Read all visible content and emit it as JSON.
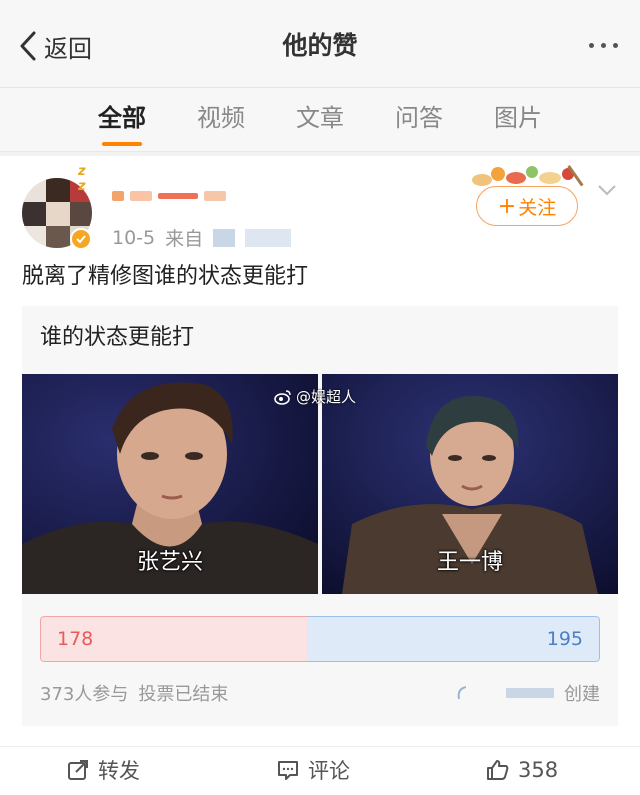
{
  "navbar": {
    "back_label": "返回",
    "title": "他的赞"
  },
  "tabs": [
    {
      "label": "全部",
      "active": true
    },
    {
      "label": "视频",
      "active": false
    },
    {
      "label": "文章",
      "active": false
    },
    {
      "label": "问答",
      "active": false
    },
    {
      "label": "图片",
      "active": false
    }
  ],
  "post": {
    "date": "10-5",
    "source_prefix": "来自",
    "follow_label": "关注",
    "text": "脱离了精修图谁的状态更能打"
  },
  "poll": {
    "title": "谁的状态更能打",
    "watermark": "@娱超人",
    "options": [
      {
        "label": "张艺兴",
        "votes": 178
      },
      {
        "label": "王一博",
        "votes": 195
      }
    ],
    "participants": "373人参与",
    "status": "投票已结束",
    "created_label": "创建"
  },
  "actions": {
    "repost": "转发",
    "comment": "评论",
    "like_count": "358"
  },
  "colors": {
    "accent": "#ff8200",
    "vote_left": "#e95a5a",
    "vote_right": "#4a7fc9"
  }
}
